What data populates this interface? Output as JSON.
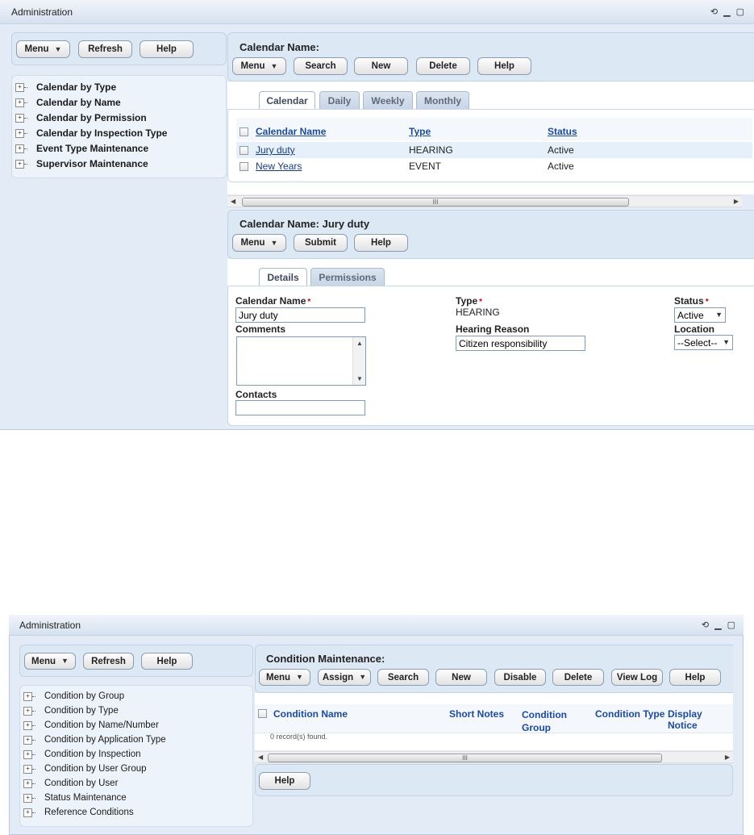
{
  "top": {
    "window_title": "Administration",
    "left_toolbar": {
      "menu": "Menu",
      "refresh": "Refresh",
      "help": "Help"
    },
    "tree": [
      "Calendar by Type",
      "Calendar by Name",
      "Calendar by Permission",
      "Calendar by Inspection Type",
      "Event Type Maintenance",
      "Supervisor Maintenance"
    ],
    "calendar_panel": {
      "title": "Calendar Name:",
      "buttons": {
        "menu": "Menu",
        "search": "Search",
        "new": "New",
        "delete": "Delete",
        "help": "Help"
      },
      "tabs": [
        "Calendar",
        "Daily",
        "Weekly",
        "Monthly"
      ],
      "columns": {
        "name": "Calendar Name",
        "type": "Type",
        "status": "Status"
      },
      "rows": [
        {
          "name": "Jury duty",
          "type": "HEARING",
          "status": "Active"
        },
        {
          "name": "New Years",
          "type": "EVENT",
          "status": "Active"
        }
      ],
      "scroll_grip": "III"
    },
    "detail_panel": {
      "title": "Calendar Name: Jury duty",
      "buttons": {
        "menu": "Menu",
        "submit": "Submit",
        "help": "Help"
      },
      "tabs": [
        "Details",
        "Permissions"
      ],
      "fields": {
        "calendar_name_label": "Calendar Name",
        "calendar_name_value": "Jury duty",
        "comments_label": "Comments",
        "contacts_label": "Contacts",
        "type_label": "Type",
        "type_value": "HEARING",
        "hearing_reason_label": "Hearing Reason",
        "hearing_reason_value": "Citizen responsibility",
        "status_label": "Status",
        "status_value": "Active",
        "location_label": "Location",
        "location_value": "--Select--"
      },
      "required_mark": "*"
    }
  },
  "bottom": {
    "window_title": "Administration",
    "left_toolbar": {
      "menu": "Menu",
      "refresh": "Refresh",
      "help": "Help"
    },
    "tree": [
      "Condition by Group",
      "Condition by Type",
      "Condition by Name/Number",
      "Condition by Application Type",
      "Condition by Inspection",
      "Condition by User Group",
      "Condition by User",
      "Status Maintenance",
      "Reference Conditions"
    ],
    "condition_panel": {
      "title": "Condition Maintenance:",
      "buttons": {
        "menu": "Menu",
        "assign": "Assign",
        "search": "Search",
        "new": "New",
        "disable": "Disable",
        "delete": "Delete",
        "view_log": "View Log",
        "help": "Help"
      },
      "columns": {
        "name": "Condition Name",
        "short_notes": "Short Notes",
        "group_line1": "Condition",
        "group_line2": "Group",
        "type": "Condition Type",
        "notice": "Display Notice"
      },
      "empty_message": "0 record(s) found.",
      "scroll_grip": "III",
      "footer_help": "Help"
    }
  }
}
